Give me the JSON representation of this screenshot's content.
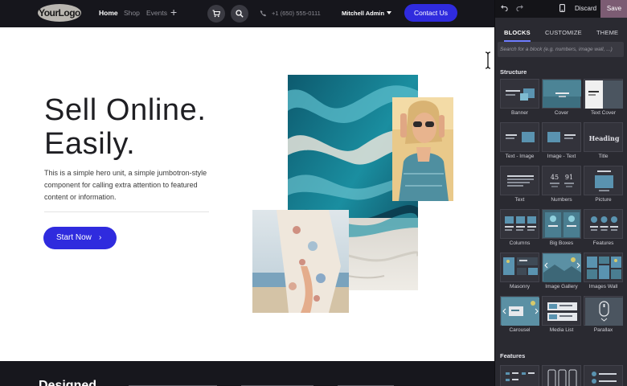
{
  "site": {
    "logo": "YourLogo",
    "nav": {
      "home": "Home",
      "shop": "Shop",
      "events": "Events",
      "plus": "+",
      "phone": "+1 (650) 555-0111",
      "user": "Mitchell Admin",
      "contact": "Contact Us"
    },
    "hero": {
      "title_line1": "Sell Online.",
      "title_line2": "Easily.",
      "description": "This is a simple hero unit, a simple jumbotron-style component for calling extra attention to featured content or information.",
      "cta": "Start Now",
      "cta_chevron": "›"
    },
    "next_section_title": "Designed"
  },
  "panel": {
    "discard": "Discard",
    "save": "Save",
    "tabs": [
      "BLOCKS",
      "CUSTOMIZE",
      "THEME"
    ],
    "search_placeholder": "Search for a block (e.g. numbers, image wall, ...)",
    "sections": {
      "structure": "Structure",
      "features": "Features"
    },
    "blocks": [
      "Banner",
      "Cover",
      "Text Cover",
      "Text - Image",
      "Image - Text",
      "Title",
      "Text",
      "Numbers",
      "Picture",
      "Columns",
      "Big Boxes",
      "Features",
      "Masonry",
      "Image Gallery",
      "Images Wall",
      "Carousel",
      "Media List",
      "Parallax"
    ],
    "title_thumb_text": "Heading",
    "numbers_thumb_text": [
      "45",
      "91"
    ]
  },
  "colors": {
    "accent": "#2f2bde",
    "save": "#7c5c73",
    "nav_bg": "#16161c",
    "panel_bg": "#2a2a31"
  }
}
